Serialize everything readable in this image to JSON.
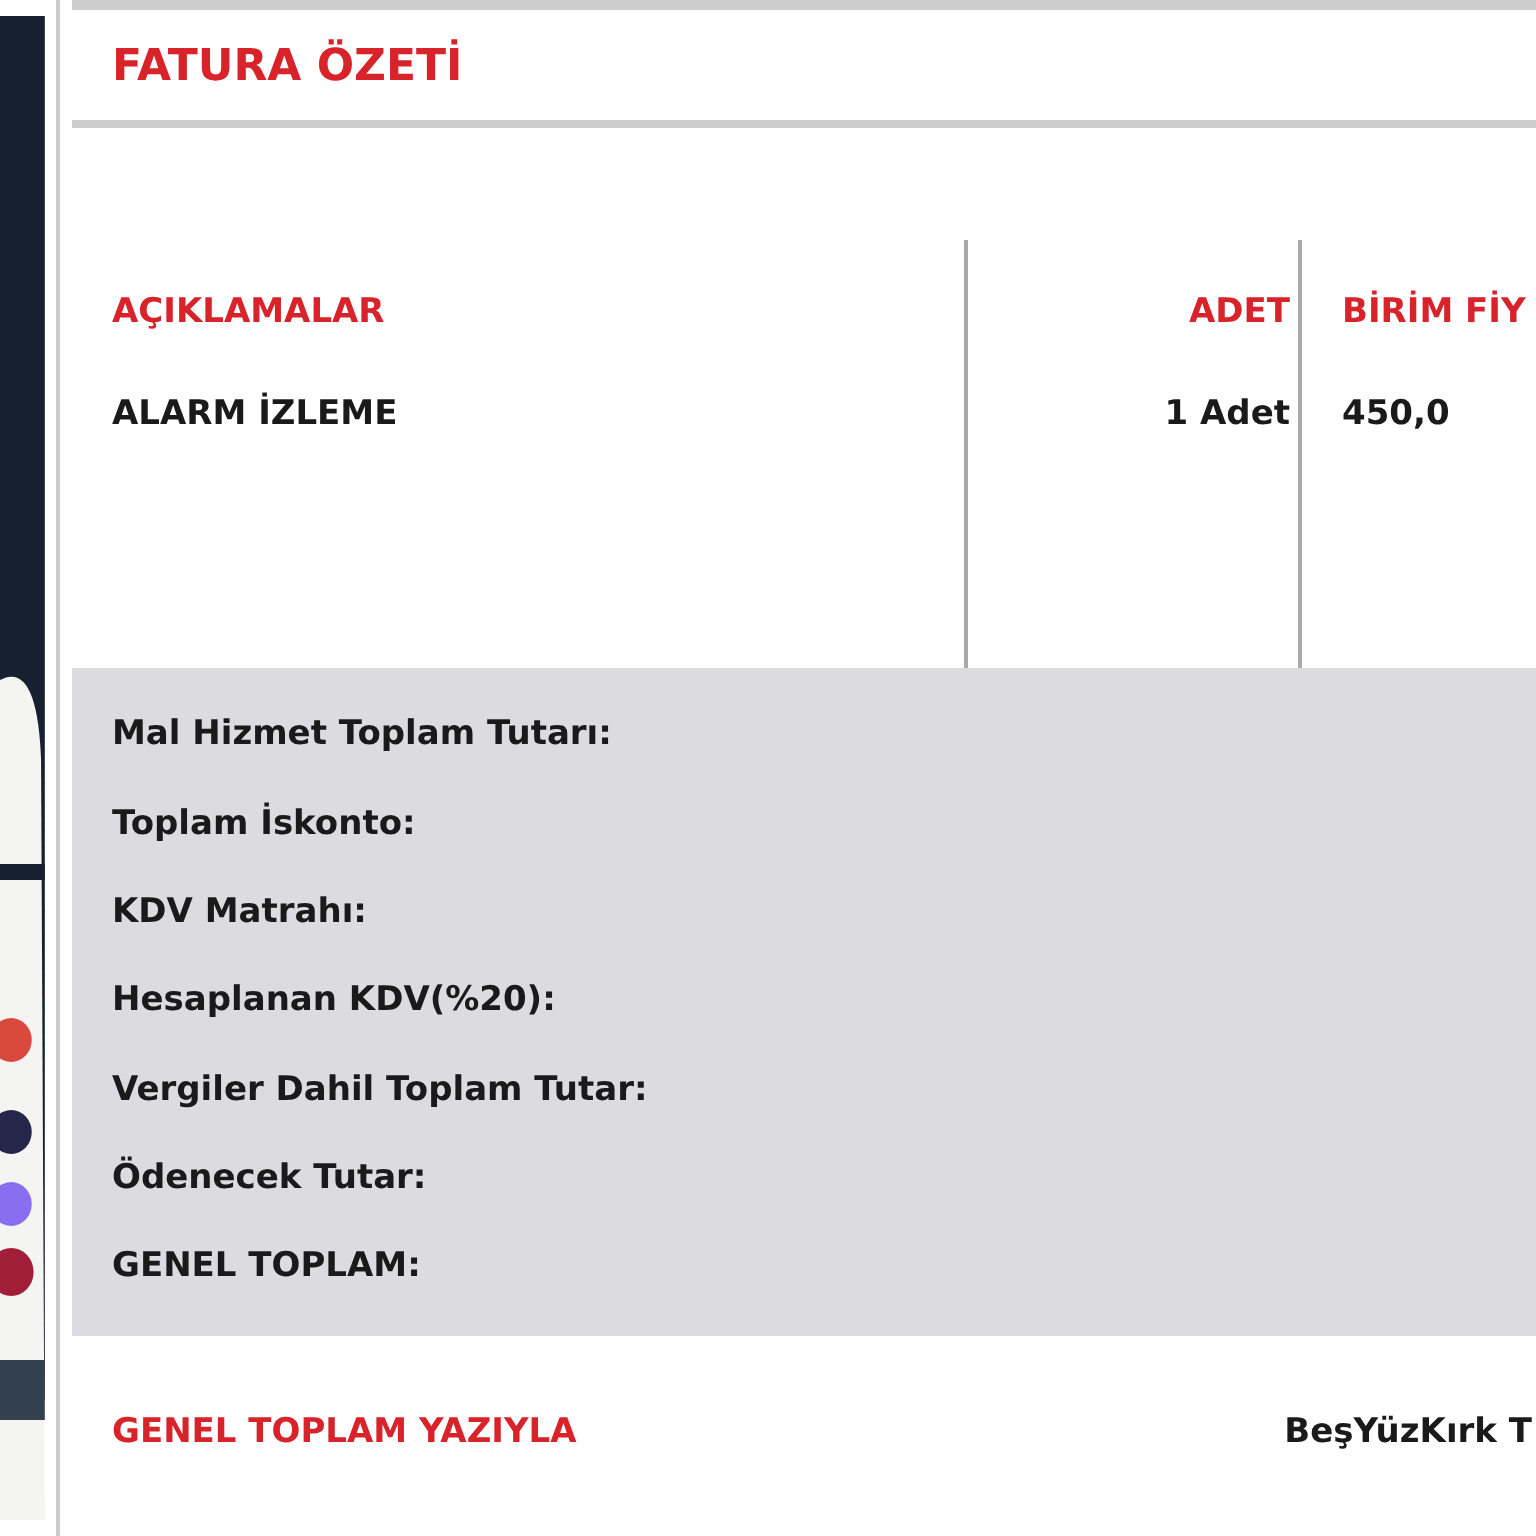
{
  "title": "FATURA ÖZETİ",
  "table": {
    "columns": [
      "AÇIKLAMALAR",
      "ADET",
      "BİRİM FİY"
    ],
    "rows": [
      [
        "ALARM İZLEME",
        "1 Adet",
        "450,0"
      ]
    ]
  },
  "summary": [
    "Mal Hizmet Toplam Tutarı:",
    "Toplam İskonto:",
    "KDV Matrahı:",
    "Hesaplanan KDV(%20):",
    "Vergiler Dahil Toplam Tutar:",
    "Ödenecek Tutar:",
    "GENEL TOPLAM:"
  ],
  "total_in_words": {
    "label": "GENEL TOPLAM YAZIYLA",
    "value": "BeşYüzKırk T"
  }
}
